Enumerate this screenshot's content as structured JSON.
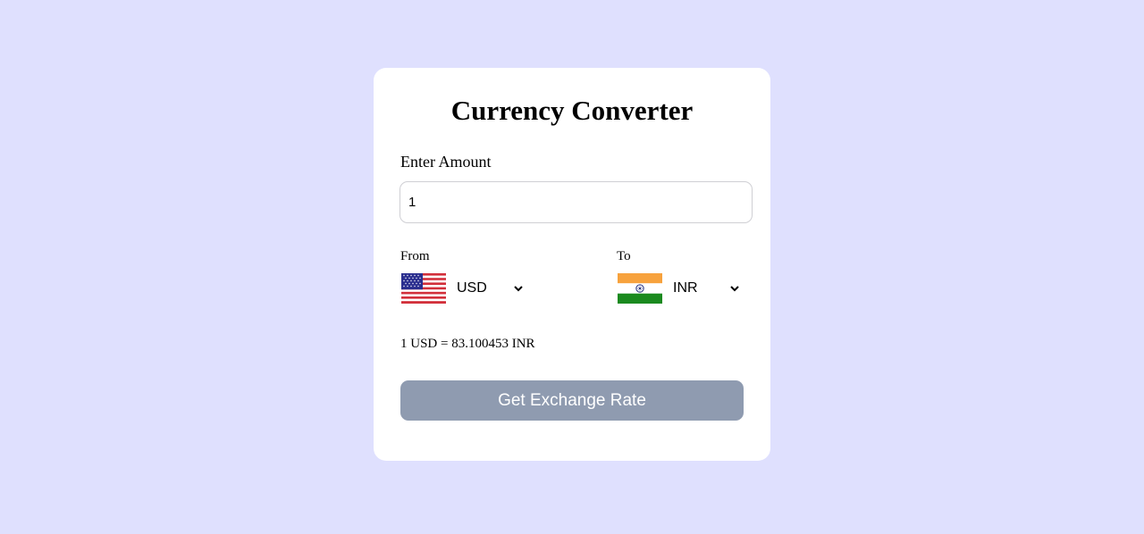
{
  "converter": {
    "title": "Currency Converter",
    "amount_label": "Enter Amount",
    "amount_value": "1",
    "from_label": "From",
    "to_label": "To",
    "from": {
      "code": "USD",
      "flag_icon": "us-flag-icon"
    },
    "to": {
      "code": "INR",
      "flag_icon": "india-flag-icon"
    },
    "result_text": "1 USD = 83.100453 INR",
    "button_label": "Get Exchange Rate"
  },
  "colors": {
    "page_background": "#dfe0fe",
    "card_background": "#ffffff",
    "button_background": "#8f9bb0",
    "button_text": "#ffffff"
  }
}
